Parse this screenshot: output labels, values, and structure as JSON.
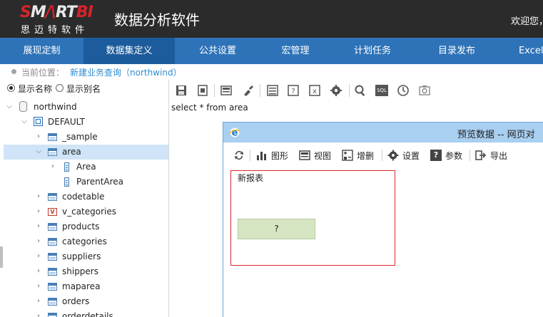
{
  "header": {
    "logo_brand": "SMARTBI",
    "logo_subtitle": "思迈特软件",
    "app_title": "数据分析软件",
    "welcome": "欢迎您，"
  },
  "nav": {
    "items": [
      {
        "label": "展现定制"
      },
      {
        "label": "数据集定义"
      },
      {
        "label": "公共设置"
      },
      {
        "label": "宏管理"
      },
      {
        "label": "计划任务"
      },
      {
        "label": "目录发布"
      },
      {
        "label": "Excel"
      }
    ],
    "active_index": 1
  },
  "breadcrumb": {
    "label": "当前位置：",
    "value": "新建业务查询（northwind）"
  },
  "display_options": {
    "show_name": "显示名称",
    "show_alias": "显示别名",
    "selected": "show_name"
  },
  "tree": {
    "database": "northwind",
    "schema": "DEFAULT",
    "tables": [
      {
        "label": "_sample",
        "type": "table"
      },
      {
        "label": "area",
        "type": "table",
        "expanded": true,
        "selected": true,
        "columns": [
          "Area",
          "ParentArea"
        ]
      },
      {
        "label": "codetable",
        "type": "table"
      },
      {
        "label": "v_categories",
        "type": "view"
      },
      {
        "label": "products",
        "type": "table"
      },
      {
        "label": "categories",
        "type": "table"
      },
      {
        "label": "suppliers",
        "type": "table"
      },
      {
        "label": "shippers",
        "type": "table"
      },
      {
        "label": "maparea",
        "type": "table"
      },
      {
        "label": "orders",
        "type": "table"
      },
      {
        "label": "orderdetails",
        "type": "table"
      }
    ]
  },
  "toolbar": {
    "icons": [
      "save-icon",
      "save-as-icon",
      "layout-icon",
      "clean-icon",
      "properties-icon",
      "help-form-icon",
      "excel-icon",
      "settings-icon",
      "search-icon",
      "sql-icon",
      "clock-icon",
      "cache-icon"
    ],
    "sql_badge": "SQL"
  },
  "query": {
    "sql": "select * from area"
  },
  "dialog": {
    "title": "预览数据 -- 网页对",
    "toolbar": [
      {
        "label": "",
        "icon": "refresh-icon"
      },
      {
        "label": "图形",
        "icon": "chart-icon"
      },
      {
        "label": "视图",
        "icon": "view-icon"
      },
      {
        "label": "增删",
        "icon": "add-remove-icon"
      },
      {
        "label": "设置",
        "icon": "gear-icon"
      },
      {
        "label": "参数",
        "icon": "help-icon"
      },
      {
        "label": "导出",
        "icon": "export-icon"
      }
    ],
    "help_glyph": "?",
    "report": {
      "name": "新报表",
      "cell_value": "?"
    }
  },
  "colors": {
    "header_bg": "#2b2b2b",
    "nav_bg": "#2e73b8",
    "nav_active": "#1d5c9c",
    "breadcrumb_link": "#2e8bd0",
    "selected_row": "#cfe5f7",
    "dialog_title": "#a9cff1",
    "report_border": "#d9272e",
    "report_cell": "#d6e5c2"
  }
}
